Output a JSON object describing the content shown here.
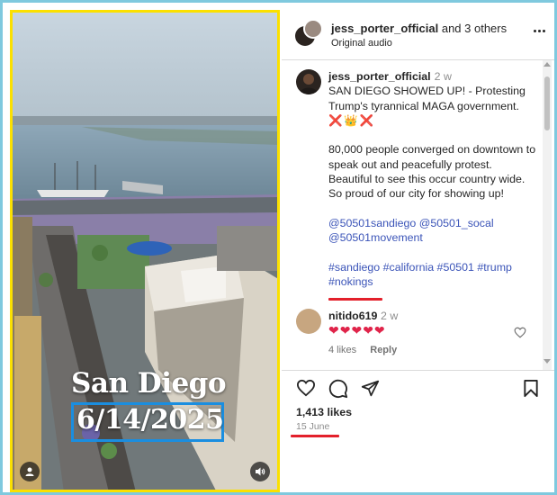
{
  "video": {
    "title_line1": "San Diego",
    "title_line2": "6/14/2025"
  },
  "header": {
    "username": "jess_porter_official",
    "others": "and 3 others",
    "subtitle": "Original audio"
  },
  "caption": {
    "username": "jess_porter_official",
    "time": "2 w",
    "text1": "SAN DIEGO SHOWED UP! - Protesting Trump's tyrannical MAGA government.",
    "emojis": "❌👑❌",
    "text2": "80,000 people converged on downtown to speak out and peacefully protest. Beautiful to see this occur country wide. So proud of our city for showing up!",
    "mentions": "@50501sandiego @50501_socal @50501movement",
    "hashtags": "#sandiego #california #50501 #trump",
    "hashtag_last": "#nokings"
  },
  "comment": {
    "username": "nitido619",
    "time": "2 w",
    "text": "❤❤❤❤❤",
    "likes": "4 likes",
    "reply": "Reply"
  },
  "post": {
    "likes": "1,413 likes",
    "date": "15 June"
  }
}
